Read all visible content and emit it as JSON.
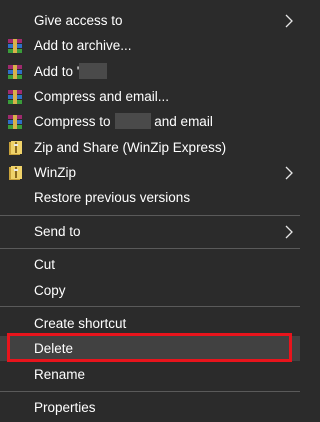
{
  "menu": {
    "items": [
      {
        "label": "Give access to",
        "icon": "none",
        "submenu": true
      },
      {
        "label": "Add to archive...",
        "icon": "winrar-icon"
      },
      {
        "label_prefix": "Add to '",
        "icon": "winrar-icon"
      },
      {
        "label": "Compress and email...",
        "icon": "winrar-icon"
      },
      {
        "label_prefix": "Compress to",
        "label_suffix": " and email",
        "icon": "winrar-icon"
      },
      {
        "label": "Zip and Share (WinZip Express)",
        "icon": "winzip-icon"
      },
      {
        "label": "WinZip",
        "icon": "winzip-icon",
        "submenu": true
      },
      {
        "label": "Restore previous versions",
        "icon": "none"
      },
      {
        "label": "Send to",
        "icon": "none",
        "submenu": true
      },
      {
        "label": "Cut",
        "icon": "none"
      },
      {
        "label": "Copy",
        "icon": "none"
      },
      {
        "label": "Create shortcut",
        "icon": "none"
      },
      {
        "label": "Delete",
        "icon": "none",
        "highlighted": true
      },
      {
        "label": "Rename",
        "icon": "none"
      },
      {
        "label": "Properties",
        "icon": "none"
      }
    ]
  },
  "colors": {
    "background": "#2b2b2b",
    "text": "#ffffff",
    "separator": "#5a5a5a",
    "highlight_box": "#e8141c"
  }
}
